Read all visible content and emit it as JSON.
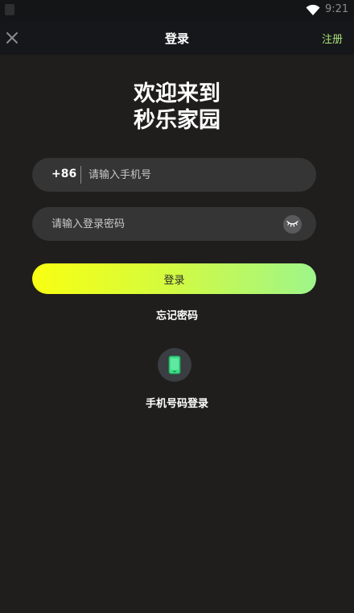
{
  "status_bar": {
    "time": "9:21",
    "wifi_icon": "wifi-icon"
  },
  "header": {
    "close_icon": "close-icon",
    "title": "登录",
    "register_label": "注册"
  },
  "welcome": {
    "line1": "欢迎来到",
    "line2": "秒乐家园"
  },
  "phone_field": {
    "country_code": "+86",
    "value": "",
    "placeholder": "请输入手机号"
  },
  "password_field": {
    "value": "",
    "placeholder": "请输入登录密码",
    "toggle_icon": "eye-closed-icon"
  },
  "login_button": {
    "label": "登录"
  },
  "forgot_password": {
    "label": "忘记密码"
  },
  "phone_login": {
    "icon": "mobile-phone-icon",
    "label": "手机号码登录"
  },
  "colors": {
    "background": "#1f1e1d",
    "header_bg": "#16171a",
    "field_bg": "#353535",
    "accent_green": "#a8e27a",
    "button_gradient_start": "#f8ff12",
    "button_gradient_end": "#9ef58a",
    "phone_icon_green": "#3ddc84"
  }
}
